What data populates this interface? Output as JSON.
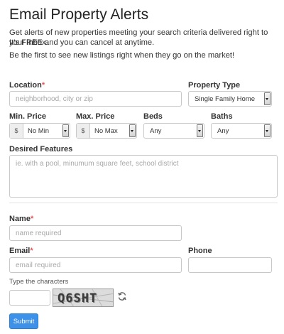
{
  "header": {
    "title": "Email Property Alerts",
    "intro_line1": "Get alerts of new properties meeting your search criteria delivered right to your inbox.",
    "intro_line2": "It's FREE and you can cancel at anytime.",
    "intro_line3": "Be the first to see new listings right when they go on the market!"
  },
  "location": {
    "label": "Location",
    "required_mark": "*",
    "placeholder": "neighborhood, city or zip"
  },
  "property_type": {
    "label": "Property Type",
    "value": "Single Family Home"
  },
  "min_price": {
    "label": "Min. Price",
    "addon": "$",
    "value": "No Min"
  },
  "max_price": {
    "label": "Max. Price",
    "addon": "$",
    "value": "No Max"
  },
  "beds": {
    "label": "Beds",
    "value": "Any"
  },
  "baths": {
    "label": "Baths",
    "value": "Any"
  },
  "features": {
    "label": "Desired Features",
    "placeholder": "ie. with a pool, minumum square feet, school district"
  },
  "name": {
    "label": "Name",
    "required_mark": "*",
    "placeholder": "name required"
  },
  "email": {
    "label": "Email",
    "required_mark": "*",
    "placeholder": "email required"
  },
  "phone": {
    "label": "Phone",
    "placeholder": ""
  },
  "captcha": {
    "label": "Type the characters",
    "code": "Q6SHT"
  },
  "submit": {
    "label": "Submit"
  },
  "icons": {
    "refresh": "refresh-icon"
  }
}
